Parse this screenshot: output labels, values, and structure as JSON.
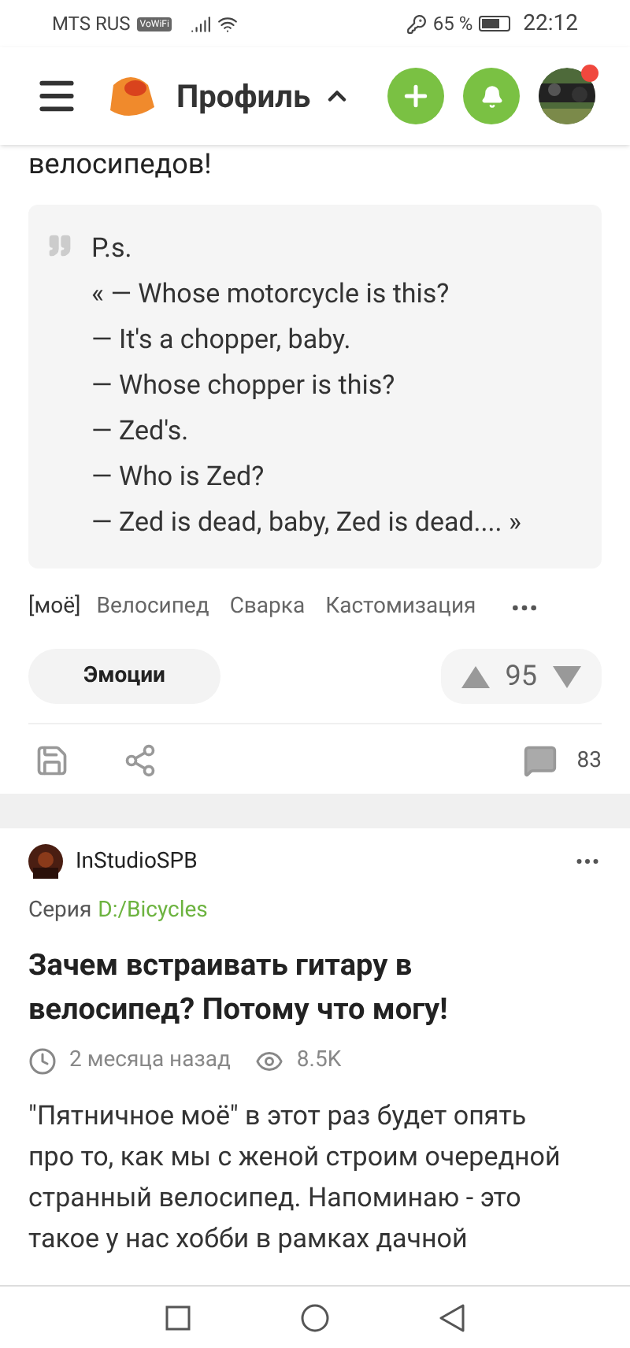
{
  "status_bar": {
    "carrier": "MTS RUS",
    "wifi_badge": "VoWiFi",
    "battery": "65 %",
    "time": "22:12"
  },
  "header": {
    "title": "Профиль",
    "notifications_dot": true
  },
  "post": {
    "text_tail": "велосипедов!",
    "quote": {
      "heading": "P.s.",
      "lines": [
        "« — Whose motorcycle is this?",
        "— It's a chopper, baby.",
        "— Whose chopper is this?",
        "— Zed's.",
        "— Who is Zed?",
        "— Zed is dead, baby, Zed is dead.... »"
      ]
    },
    "tags": [
      "[моё]",
      "Велосипед",
      "Сварка",
      "Кастомизация"
    ],
    "emotions_button": "Эмоции",
    "rating": "95",
    "comments": "83"
  },
  "next_post": {
    "author": "InStudioSPB",
    "series_label": "Серия",
    "series": "D:/Bicycles",
    "title": "Зачем встраивать гитару в велосипед? Потому что могу!",
    "age": "2 месяца назад",
    "views": "8.5K",
    "body": "\"Пятничное моё\" в этот раз будет опять про то, как мы с женой строим очередной странный велосипед. Напоминаю - это такое у нас хобби в рамках дачной"
  }
}
